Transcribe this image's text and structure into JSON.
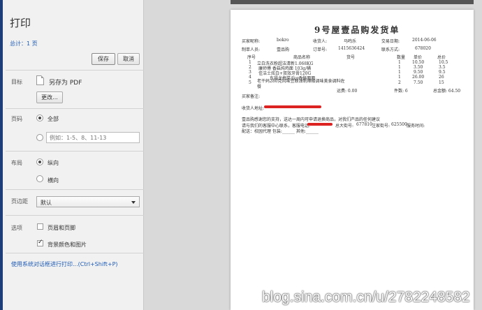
{
  "sidebar": {
    "title": "打印",
    "total": "总计：1 页",
    "save_label": "保存",
    "cancel_label": "取消",
    "destination": {
      "label": "目标",
      "name": "另存为 PDF",
      "change_label": "更改..."
    },
    "pages": {
      "label": "页码",
      "all_label": "全部",
      "range_placeholder": "例如：1-5、8、11-13"
    },
    "layout": {
      "label": "布局",
      "portrait_label": "纵向",
      "landscape_label": "横向"
    },
    "margins": {
      "label": "页边距",
      "value": "默认"
    },
    "options": {
      "label": "选项",
      "header_footer_label": "页眉和页脚",
      "background_label": "背景颜色和图片"
    },
    "system_dialog_link": "使用系统对话框进行打印...(Ctrl+Shift+P)"
  },
  "preview": {
    "title": "9号屋壹品购发货单",
    "row1": {
      "k1": "买家昵称:",
      "v1": "bokro",
      "k2": "收货人:",
      "v2": "马鸣乐",
      "k3": "交易日期:",
      "v3": "2014-06-06"
    },
    "row2": {
      "k1": "制单人员:",
      "v1": "壹品购",
      "k2": "订单号:",
      "v2": "1415636424",
      "k3": "联系方式:",
      "v3": "678020"
    },
    "headers": {
      "no": "序号",
      "name": "商品名称",
      "code": "货号",
      "qty": "数量",
      "price": "单价",
      "total": "总价"
    },
    "items": [
      {
        "no": "1",
        "name": "立白洗衣粉超洁清新1.068KG",
        "qty": "1",
        "price": "10.50",
        "total": "10.5"
      },
      {
        "no": "2",
        "name": "康师傅 香菇炖鸡面 103g/桶",
        "qty": "1",
        "price": "3.50",
        "total": "3.5"
      },
      {
        "no": "3",
        "name": "佳洁士炫白+双效牙膏120G",
        "qty": "1",
        "price": "9.50",
        "total": "9.5"
      },
      {
        "no": "4",
        "name": "东福龙梅菜4kg香酥面面",
        "qty": "1",
        "price": "26.00",
        "total": "26"
      },
      {
        "no": "5",
        "name": "老干妈280克风味豆豉油制辣椒调味美食调料佐餐",
        "qty": "2",
        "price": "7.50",
        "total": "15"
      }
    ],
    "freight": "运费: 0.00",
    "count": "件数: 6",
    "amount": "总金额: 64.50",
    "buyer_note_label": "买家备注:",
    "address_label": "收货人地址:",
    "thanks": "壹品购感谢您的支持，送达一周内可申请退换商品，对我们产品的任何建议",
    "contact_prefix": "请与我们的客服中心联系，客服电话:",
    "contact_phone_label": "总大街号:",
    "contact_phone": "677810",
    "contact_service_label": "注家街号:",
    "contact_service": "625500",
    "contact_suffix": "服务时间:",
    "delivery": "配送：校园代理    包装:______    其他:______"
  },
  "watermark": "blog.sina.com.cn/u/2782248582"
}
